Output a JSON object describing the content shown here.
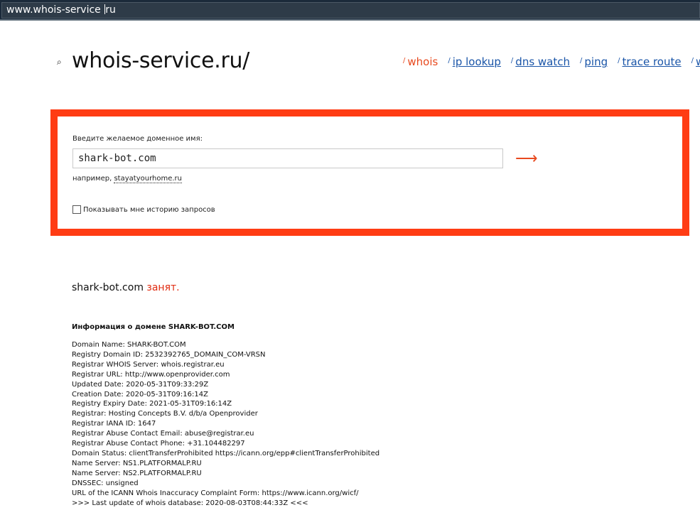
{
  "browser": {
    "url_before_caret": "www.whois-service ",
    "url_after_caret": "ru"
  },
  "header": {
    "logo_icon": "⌕",
    "logo_text": "whois-service.ru/",
    "nav": [
      {
        "tick": "/",
        "label": "whois",
        "active": true
      },
      {
        "tick": "/",
        "label": "ip lookup",
        "active": false
      },
      {
        "tick": "/",
        "label": "dns watch",
        "active": false
      },
      {
        "tick": "/",
        "label": "ping",
        "active": false
      },
      {
        "tick": "/",
        "label": "trace route",
        "active": false
      },
      {
        "tick": "/",
        "label": "wh",
        "active": false
      }
    ]
  },
  "search": {
    "label": "Введите желаемое доменное имя:",
    "input_value": "shark-bot.com",
    "submit_symbol": "⟶",
    "example_prefix": "например,",
    "example_link": "stayatyourhome.ru",
    "history_label": "Показывать мне историю запросов",
    "history_checked": false
  },
  "result": {
    "domain": "shark-bot.com",
    "status": "занят."
  },
  "whois": {
    "title": "Информация о домене SHARK-BOT.COM",
    "lines": [
      "Domain Name: SHARK-BOT.COM",
      "Registry Domain ID: 2532392765_DOMAIN_COM-VRSN",
      "Registrar WHOIS Server: whois.registrar.eu",
      "Registrar URL: http://www.openprovider.com",
      "Updated Date: 2020-05-31T09:33:29Z",
      "Creation Date: 2020-05-31T09:16:14Z",
      "Registry Expiry Date: 2021-05-31T09:16:14Z",
      "Registrar: Hosting Concepts B.V. d/b/a Openprovider",
      "Registrar IANA ID: 1647",
      "Registrar Abuse Contact Email: abuse@registrar.eu",
      "Registrar Abuse Contact Phone: +31.104482297",
      "Domain Status: clientTransferProhibited https://icann.org/epp#clientTransferProhibited",
      "Name Server: NS1.PLATFORMALP.RU",
      "Name Server: NS2.PLATFORMALP.RU",
      "DNSSEC: unsigned",
      "URL of the ICANN Whois Inaccuracy Complaint Form: https://www.icann.org/wicf/",
      ">>> Last update of whois database: 2020-08-03T08:44:33Z <<<"
    ]
  },
  "colors": {
    "accent": "#e84a1f",
    "frame": "#ff3c14",
    "link": "#1a55a8",
    "status": "#e02b10",
    "addressbar": "#1b2a3a"
  }
}
